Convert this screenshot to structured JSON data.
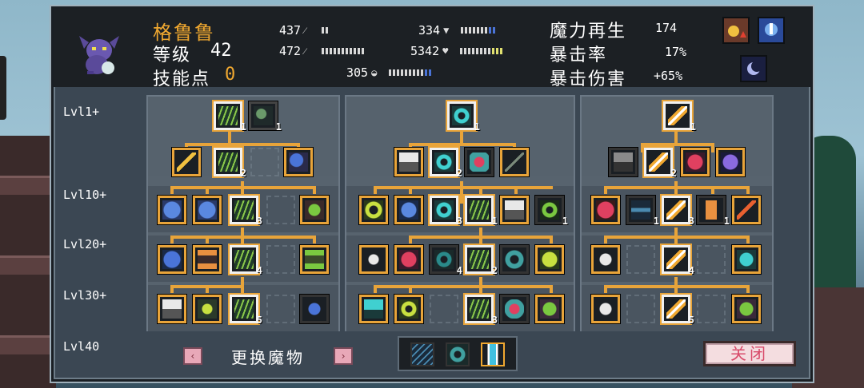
{
  "monster": {
    "name": "格鲁鲁",
    "level_label": "等级",
    "level": "42",
    "skill_points_label": "技能点",
    "skill_points": "0"
  },
  "stats": {
    "attack": "437",
    "magic_attack": "472",
    "defense": "334",
    "health": "5342",
    "mana": "305"
  },
  "right_stats": {
    "mana_regen_label": "魔力再生",
    "mana_regen": "174",
    "crit_rate_label": "暴击率",
    "crit_rate": "17%",
    "crit_damage_label": "暴击伤害",
    "crit_damage": "+65%"
  },
  "tiers": [
    "Lvl1+",
    "Lvl10+",
    "Lvl20+",
    "Lvl30+",
    "Lvl40"
  ],
  "node_counts": {
    "c1_r1_a": "1",
    "c1_r1_b": "1",
    "c1_r2": "2",
    "c1_r3": "3",
    "c1_r4": "4",
    "c1_r5": "5",
    "c2_r1": "1",
    "c2_r2": "2",
    "c2_r3_a": "3",
    "c2_r3_b": "1",
    "c2_r3_c": "1",
    "c2_r4_a": "4",
    "c2_r4_b": "2",
    "c2_r5": "3",
    "c3_r1": "1",
    "c3_r2": "2",
    "c3_r3_a": "1",
    "c3_r3_b": "3",
    "c3_r3_c": "1",
    "c3_r4": "4",
    "c3_r5": "5"
  },
  "bottom": {
    "switch_monster": "更换魔物",
    "prev_arrow": "‹",
    "next_arrow": "›",
    "close": "关闭"
  },
  "colors": {
    "accent_orange": "#e8a43a",
    "name_color": "#f0a830",
    "close_text": "#d84a6a"
  }
}
